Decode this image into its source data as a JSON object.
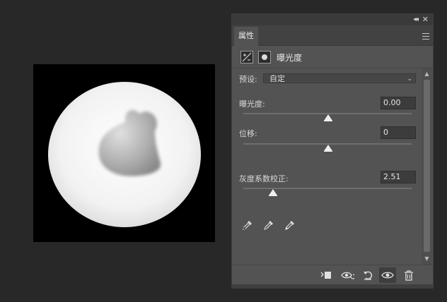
{
  "panel": {
    "tab_label": "属性",
    "title": "曝光度"
  },
  "preset": {
    "label": "预设:",
    "value": "自定"
  },
  "controls": [
    {
      "label": "曝光度:",
      "value": "0.00",
      "position": 0.5
    },
    {
      "label": "位移:",
      "value": "0",
      "position": 0.5
    },
    {
      "label": "灰度系数校正:",
      "value": "2.51",
      "position": 0.18
    }
  ],
  "footer": {
    "icons": [
      "clip-to-layer-icon",
      "view-previous-state-icon",
      "reset-icon",
      "visibility-icon",
      "trash-icon"
    ]
  }
}
